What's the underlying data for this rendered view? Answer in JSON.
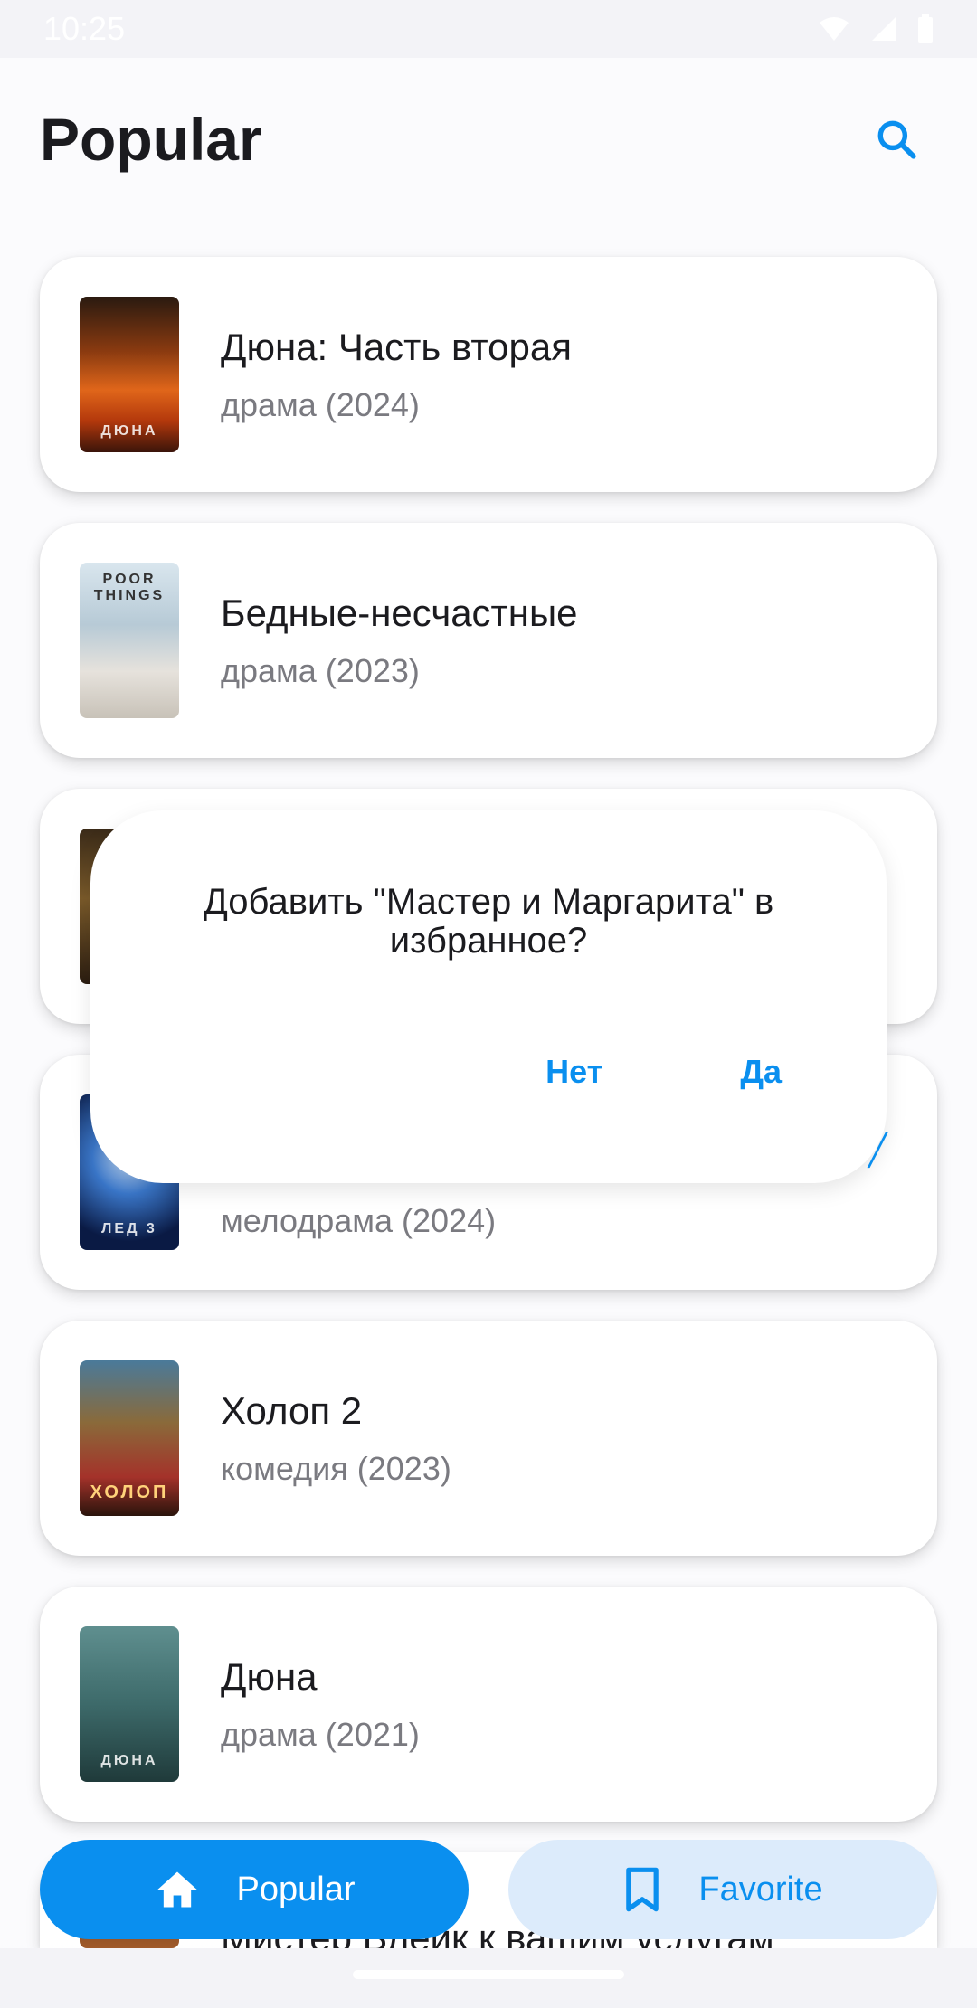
{
  "status_bar": {
    "time": "10:25"
  },
  "header": {
    "title": "Popular",
    "search_icon": "search-icon"
  },
  "movies": [
    {
      "title": "Дюна: Часть вторая",
      "genre": "драма (2024)",
      "poster_text": "ДЮНА"
    },
    {
      "title": "Бедные-несчастные",
      "genre": "драма (2023)",
      "poster_text": "POOR THINGS"
    },
    {
      "title": "Мастер и Маргарита",
      "genre": "",
      "poster_text": ""
    },
    {
      "title": "",
      "genre": "мелодрама (2024)",
      "poster_text": "ЛЕД 3"
    },
    {
      "title": "Холоп 2",
      "genre": "комедия (2023)",
      "poster_text": "ХОЛОП"
    },
    {
      "title": "Дюна",
      "genre": "драма (2021)",
      "poster_text": "ДЮНА"
    },
    {
      "title": "Мистер Блейк к вашим услугам",
      "genre": "",
      "poster_text": ""
    }
  ],
  "dialog": {
    "message": "Добавить \"Мастер и Маргарита\" в избранное?",
    "no_label": "Нет",
    "yes_label": "Да"
  },
  "bottom_nav": {
    "items": [
      {
        "label": "Popular",
        "icon": "home-icon",
        "active": true
      },
      {
        "label": "Favorite",
        "icon": "bookmark-icon",
        "active": false
      }
    ]
  },
  "colors": {
    "accent": "#0a8fef",
    "accent_light": "#dcebfb",
    "card": "#ffffff",
    "background": "#fbfbfd",
    "secondary_text": "#7a7a80"
  }
}
